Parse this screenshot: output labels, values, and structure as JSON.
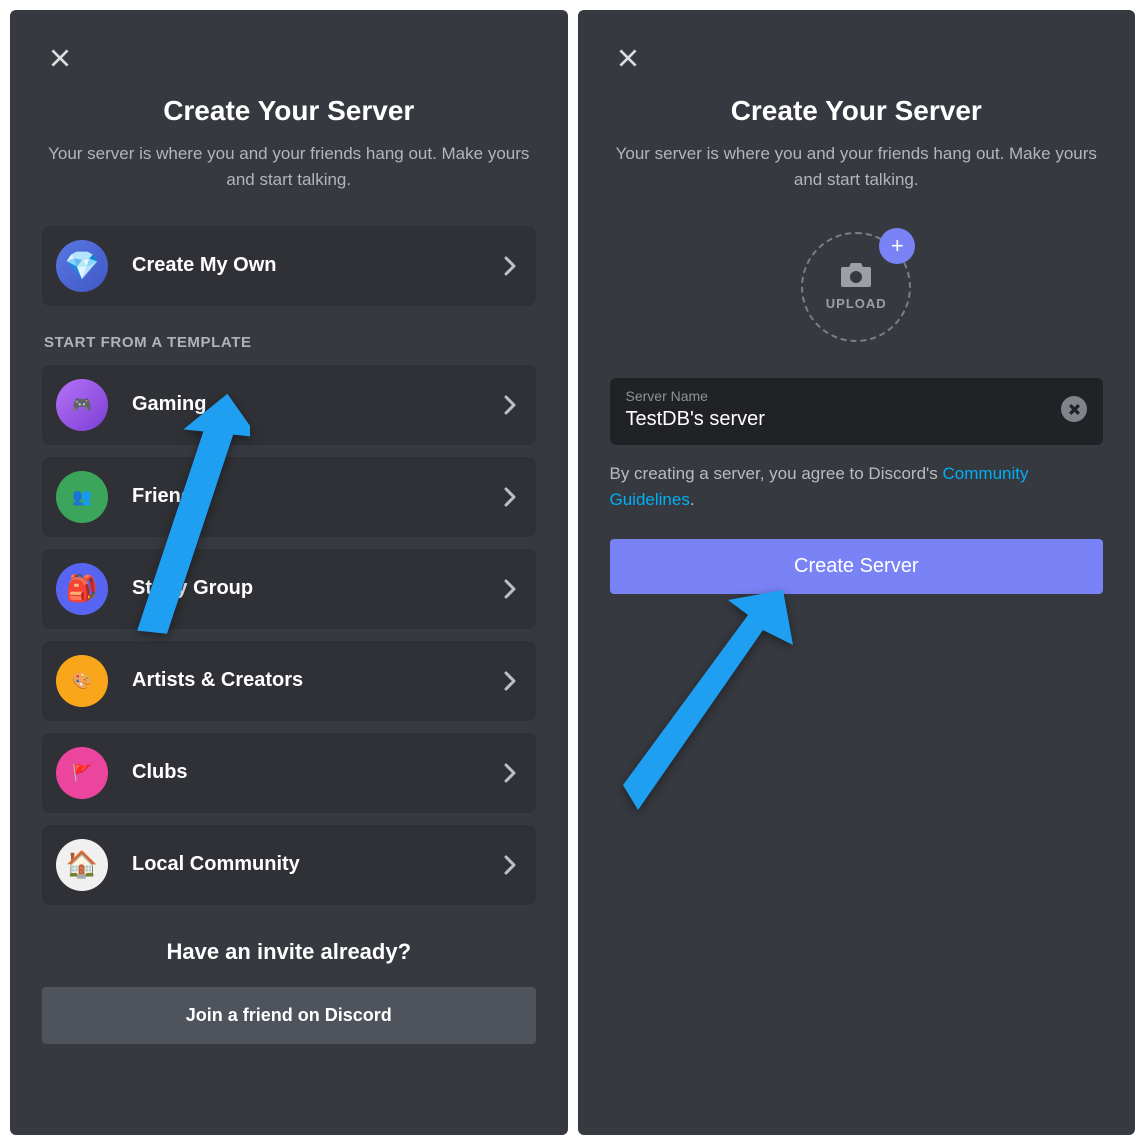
{
  "left": {
    "title": "Create Your Server",
    "subtitle": "Your server is where you and your friends hang out. Make yours and start talking.",
    "createMyOwn": "Create My Own",
    "templateHeader": "START FROM A TEMPLATE",
    "templates": [
      {
        "label": "Gaming"
      },
      {
        "label": "Friends"
      },
      {
        "label": "Study Group"
      },
      {
        "label": "Artists & Creators"
      },
      {
        "label": "Clubs"
      },
      {
        "label": "Local Community"
      }
    ],
    "invitePrompt": "Have an invite already?",
    "joinButton": "Join a friend on Discord"
  },
  "right": {
    "title": "Create Your Server",
    "subtitle": "Your server is where you and your friends hang out. Make yours and start talking.",
    "uploadLabel": "UPLOAD",
    "serverNameLabel": "Server Name",
    "serverNameValue": "TestDB's server",
    "agreePrefix": "By creating a server, you agree to Discord's ",
    "agreeLink": "Community Guidelines",
    "agreeSuffix": ".",
    "createButton": "Create Server"
  }
}
